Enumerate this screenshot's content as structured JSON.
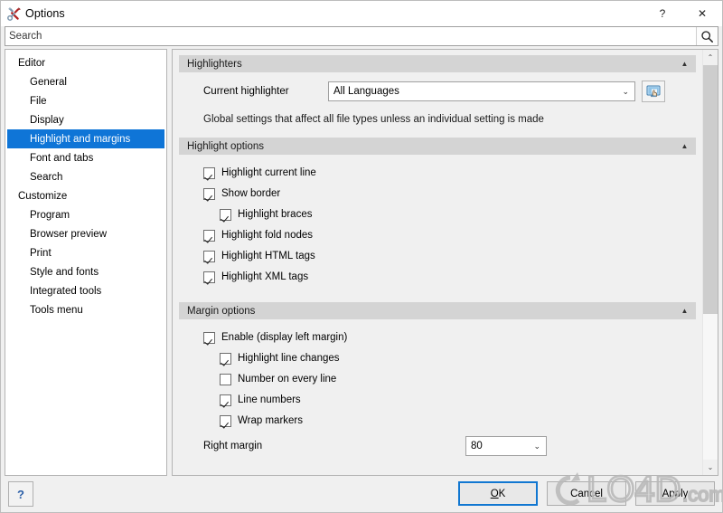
{
  "window": {
    "title": "Options",
    "icon": "tools-wrench-screwdriver-icon",
    "help_label": "?",
    "close_label": "✕"
  },
  "search": {
    "placeholder": "Search",
    "value": "",
    "icon": "search-magnifier-icon"
  },
  "sidebar": {
    "items": [
      {
        "label": "Editor",
        "level": 0,
        "selected": false
      },
      {
        "label": "General",
        "level": 1,
        "selected": false
      },
      {
        "label": "File",
        "level": 1,
        "selected": false
      },
      {
        "label": "Display",
        "level": 1,
        "selected": false
      },
      {
        "label": "Highlight and margins",
        "level": 1,
        "selected": true
      },
      {
        "label": "Font and tabs",
        "level": 1,
        "selected": false
      },
      {
        "label": "Search",
        "level": 1,
        "selected": false
      },
      {
        "label": "Customize",
        "level": 0,
        "selected": false
      },
      {
        "label": "Program",
        "level": 1,
        "selected": false
      },
      {
        "label": "Browser preview",
        "level": 1,
        "selected": false
      },
      {
        "label": "Print",
        "level": 1,
        "selected": false
      },
      {
        "label": "Style and fonts",
        "level": 1,
        "selected": false
      },
      {
        "label": "Integrated tools",
        "level": 1,
        "selected": false
      },
      {
        "label": "Tools menu",
        "level": 1,
        "selected": false
      }
    ]
  },
  "groups": {
    "highlighters": {
      "title": "Highlighters",
      "collapse_glyph": "▲",
      "current_highlighter_label": "Current highlighter",
      "current_highlighter_value": "All Languages",
      "current_highlighter_options": [
        "All Languages"
      ],
      "caret_glyph": "⌄",
      "picker_icon": "monitor-hand-picker-icon",
      "note": "Global settings that affect all file types unless an individual setting is made"
    },
    "highlight_options": {
      "title": "Highlight options",
      "collapse_glyph": "▲",
      "checkboxes": [
        {
          "label": "Highlight current line",
          "checked": true,
          "indent": false
        },
        {
          "label": "Show border",
          "checked": true,
          "indent": false
        },
        {
          "label": "Highlight braces",
          "checked": true,
          "indent": true
        },
        {
          "label": "Highlight fold nodes",
          "checked": true,
          "indent": false
        },
        {
          "label": "Highlight HTML tags",
          "checked": true,
          "indent": false
        },
        {
          "label": "Highlight XML tags",
          "checked": true,
          "indent": false
        }
      ]
    },
    "margin_options": {
      "title": "Margin options",
      "collapse_glyph": "▲",
      "checkboxes": [
        {
          "label": "Enable (display left margin)",
          "checked": true,
          "indent": false
        },
        {
          "label": "Highlight line changes",
          "checked": true,
          "indent": true
        },
        {
          "label": "Number on every line",
          "checked": false,
          "indent": true
        },
        {
          "label": "Line numbers",
          "checked": true,
          "indent": true
        },
        {
          "label": "Wrap markers",
          "checked": true,
          "indent": true
        }
      ],
      "right_margin_label": "Right margin",
      "right_margin_value": "80",
      "right_margin_options": [
        "80"
      ],
      "caret_glyph": "⌄"
    }
  },
  "scrollbar": {
    "up_glyph": "⌃",
    "down_glyph": "⌄"
  },
  "footer": {
    "help_label": "?",
    "ok_label": "OK",
    "ok_mnemonic": "O",
    "ok_rest": "K",
    "cancel_label": "Cancel",
    "apply_label": "Apply"
  },
  "watermark": {
    "text": "LO4D.com"
  },
  "colors": {
    "selection_blue": "#0f75d7",
    "group_header_gray": "#d4d4d4",
    "dialog_gray": "#f0f0f0",
    "focus_border_blue": "#1177d1",
    "help_glyph_blue": "#2b5fa8"
  }
}
